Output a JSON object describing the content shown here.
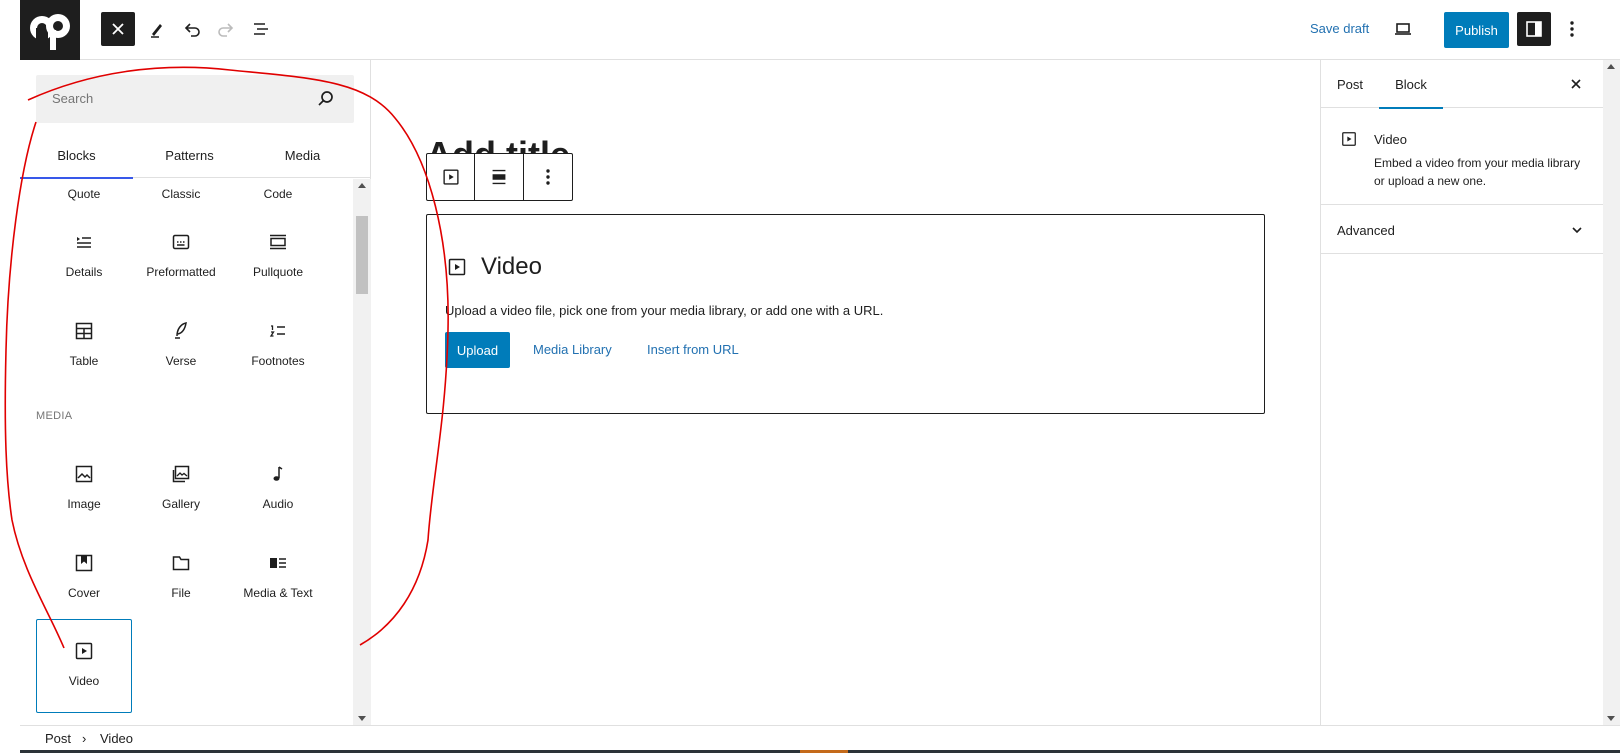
{
  "header": {
    "save_draft_label": "Save draft",
    "publish_label": "Publish"
  },
  "inserter": {
    "search_placeholder": "Search",
    "tabs": [
      {
        "label": "Blocks"
      },
      {
        "label": "Patterns"
      },
      {
        "label": "Media"
      }
    ],
    "text_blocks": [
      {
        "label": "Quote",
        "icon": "quote-icon"
      },
      {
        "label": "Classic",
        "icon": "classic-icon"
      },
      {
        "label": "Code",
        "icon": "code-icon"
      },
      {
        "label": "Details",
        "icon": "details-icon"
      },
      {
        "label": "Preformatted",
        "icon": "preformatted-icon"
      },
      {
        "label": "Pullquote",
        "icon": "pullquote-icon"
      },
      {
        "label": "Table",
        "icon": "table-icon"
      },
      {
        "label": "Verse",
        "icon": "verse-icon"
      },
      {
        "label": "Footnotes",
        "icon": "footnotes-icon"
      }
    ],
    "media_category_title": "MEDIA",
    "media_blocks": [
      {
        "label": "Image",
        "icon": "image-icon"
      },
      {
        "label": "Gallery",
        "icon": "gallery-icon"
      },
      {
        "label": "Audio",
        "icon": "audio-icon"
      },
      {
        "label": "Cover",
        "icon": "cover-icon"
      },
      {
        "label": "File",
        "icon": "file-icon"
      },
      {
        "label": "Media & Text",
        "icon": "media-text-icon"
      },
      {
        "label": "Video",
        "icon": "video-icon",
        "selected": true
      }
    ]
  },
  "canvas": {
    "title_ghost": "Add title",
    "placeholder": {
      "title": "Video",
      "instructions": "Upload a video file, pick one from your media library, or add one with a URL.",
      "upload_label": "Upload",
      "media_library_label": "Media Library",
      "insert_url_label": "Insert from URL"
    }
  },
  "settings": {
    "tabs": [
      {
        "label": "Post"
      },
      {
        "label": "Block",
        "active": true
      }
    ],
    "block_card": {
      "title": "Video",
      "description": "Embed a video from your media library or upload a new one."
    },
    "advanced_label": "Advanced"
  },
  "breadcrumb": {
    "items": [
      "Post",
      "Video"
    ],
    "separator": "›"
  },
  "colors": {
    "accent": "#007cba",
    "link": "#2271b1",
    "dark": "#1e1e1e",
    "annotation": "#e00000"
  }
}
